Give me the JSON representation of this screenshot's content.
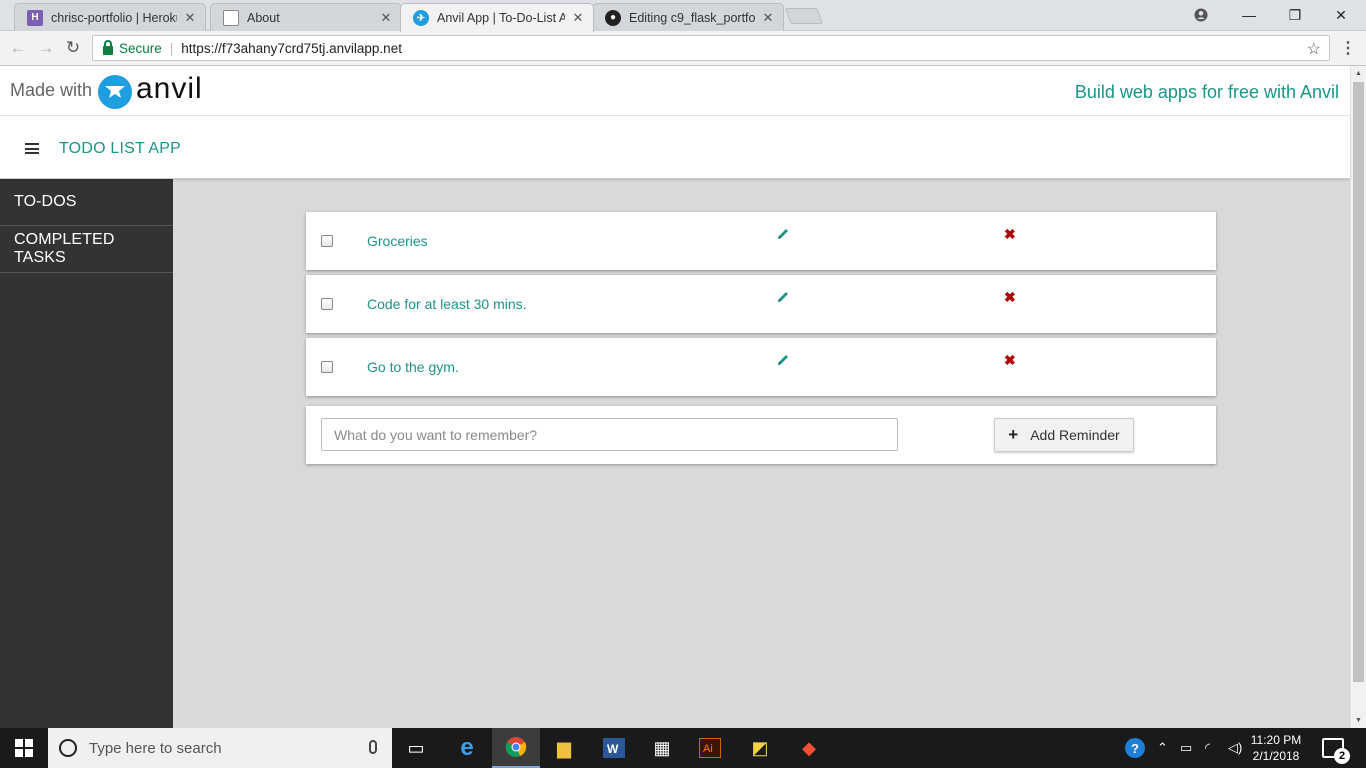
{
  "browser": {
    "tabs": [
      {
        "title": "chrisc-portfolio | Heroku",
        "favicon": "heroku-icon",
        "color": "#7b5fb0"
      },
      {
        "title": "About",
        "favicon": "page-icon",
        "color": "#888888"
      },
      {
        "title": "Anvil App | To-Do-List Ap",
        "favicon": "anvil-icon",
        "color": "#1e9de0",
        "active": true
      },
      {
        "title": "Editing c9_flask_portfolio",
        "favicon": "github-icon",
        "color": "#222222"
      }
    ],
    "address": {
      "secure_label": "Secure",
      "url": "https://f73ahany7crd75tj.anvilapp.net"
    }
  },
  "banner": {
    "made_with": "Made with",
    "brand": "anvil",
    "build_link": "Build web apps for free with Anvil"
  },
  "app": {
    "title": "TODO LIST APP"
  },
  "sidebar": {
    "items": [
      {
        "label": "TO-DOS"
      },
      {
        "label": "COMPLETED TASKS"
      }
    ]
  },
  "todos": [
    {
      "text": "Groceries",
      "checked": false
    },
    {
      "text": "Code for at least 30 mins.",
      "checked": false
    },
    {
      "text": "Go to the gym.",
      "checked": false
    }
  ],
  "add_form": {
    "placeholder": "What do you want to remember?",
    "value": "",
    "button_label": "Add Reminder"
  },
  "taskbar": {
    "search_placeholder": "Type here to search",
    "time": "11:20 PM",
    "date": "2/1/2018",
    "notification_count": "2"
  },
  "colors": {
    "accent": "#1a9688",
    "delete": "#b00000",
    "sidebar_bg": "#333333",
    "content_bg": "#d9d9d9"
  }
}
